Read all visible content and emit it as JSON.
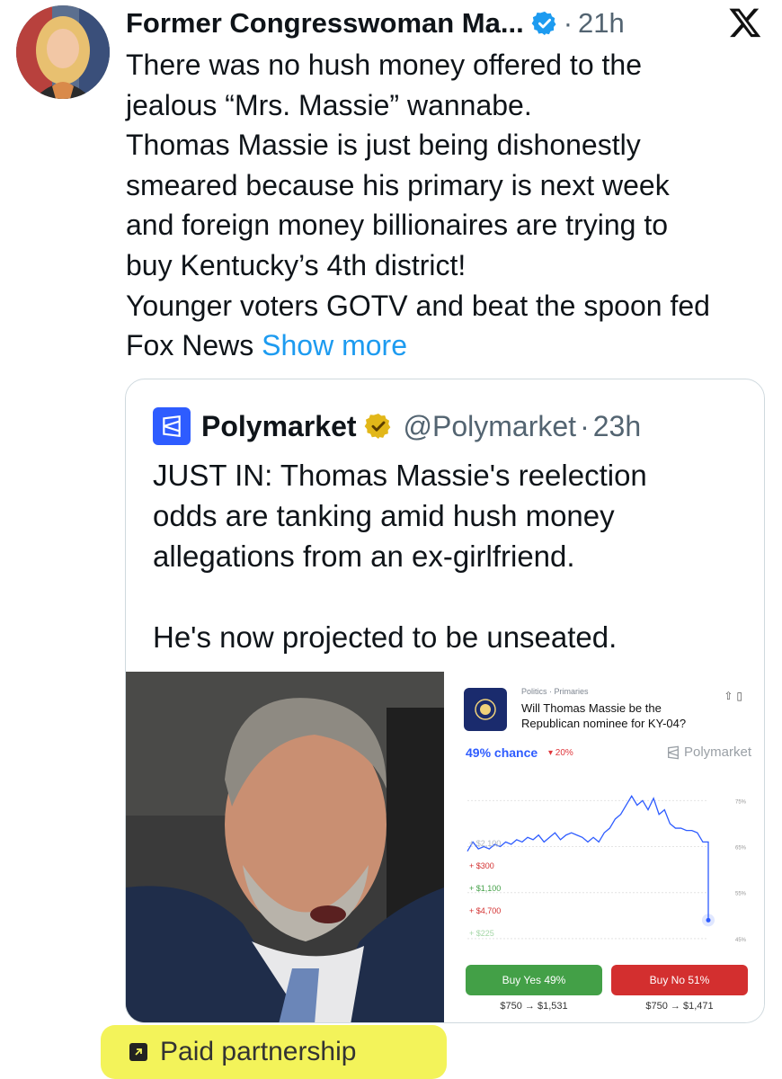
{
  "post": {
    "author_name": "Former Congresswoman Ma...",
    "separator": "·",
    "time": "21h",
    "text_lines": [
      "There was no hush money offered to the",
      "jealous “Mrs. Massie” wannabe.",
      "Thomas Massie is just being dishonestly",
      "smeared because his primary is next week",
      "and foreign money billionaires are trying to",
      "buy Kentucky’s 4th district!",
      "Younger voters GOTV and beat the spoon fed"
    ],
    "last_line": "Fox News",
    "show_more": "Show more"
  },
  "quote": {
    "name": "Polymarket",
    "handle": "@Polymarket",
    "separator": "·",
    "time": "23h",
    "text_lines": [
      "JUST IN: Thomas Massie's reelection",
      "odds are tanking amid hush money",
      "allegations from an ex-girlfriend."
    ],
    "text_line_2": "He's now projected to be unseated."
  },
  "card": {
    "category": "Politics · Primaries",
    "question": "Will Thomas Massie be the Republican nominee for KY-04?",
    "chance": "49% chance",
    "delta": "▾ 20%",
    "watermark": "Polymarket",
    "buy_yes": "Buy Yes 49%",
    "buy_no": "Buy No 51%",
    "payout_yes": "$750 → $1,531",
    "payout_no": "$750 → $1,471",
    "trades": [
      {
        "text": "+ $2,100",
        "color": "#b0b8c0"
      },
      {
        "text": "+ $300",
        "color": "#d32f2f"
      },
      {
        "text": "+ $1,100",
        "color": "#43a047"
      },
      {
        "text": "+ $4,700",
        "color": "#d32f2f"
      },
      {
        "text": "+ $225",
        "color": "#a5d6a7"
      }
    ],
    "y_ticks": [
      "75%",
      "65%",
      "55%",
      "45%"
    ]
  },
  "chart_data": {
    "type": "line",
    "title": "",
    "xlabel": "",
    "ylabel": "",
    "ylim": [
      44,
      78
    ],
    "y_ticks": [
      75,
      65,
      55,
      45
    ],
    "series": [
      {
        "values": [
          64,
          66,
          64.5,
          65,
          64.5,
          65.5,
          65,
          66,
          65.5,
          66.5,
          66,
          67,
          66.5,
          67.5,
          66,
          67,
          68,
          66.5,
          67.5,
          68,
          67.5,
          67,
          66,
          67,
          66,
          68,
          69,
          71,
          72,
          74,
          76,
          74,
          75,
          73,
          75.5,
          72,
          73,
          70,
          69,
          69,
          68.5,
          68.5,
          68,
          66,
          49
        ]
      }
    ],
    "color": "#2e5cff"
  },
  "paid": {
    "label": "Paid partnership"
  },
  "colors": {
    "accent": "#1d9bf0",
    "polymarket_blue": "#2e5cff",
    "highlight": "#f3f35a"
  }
}
